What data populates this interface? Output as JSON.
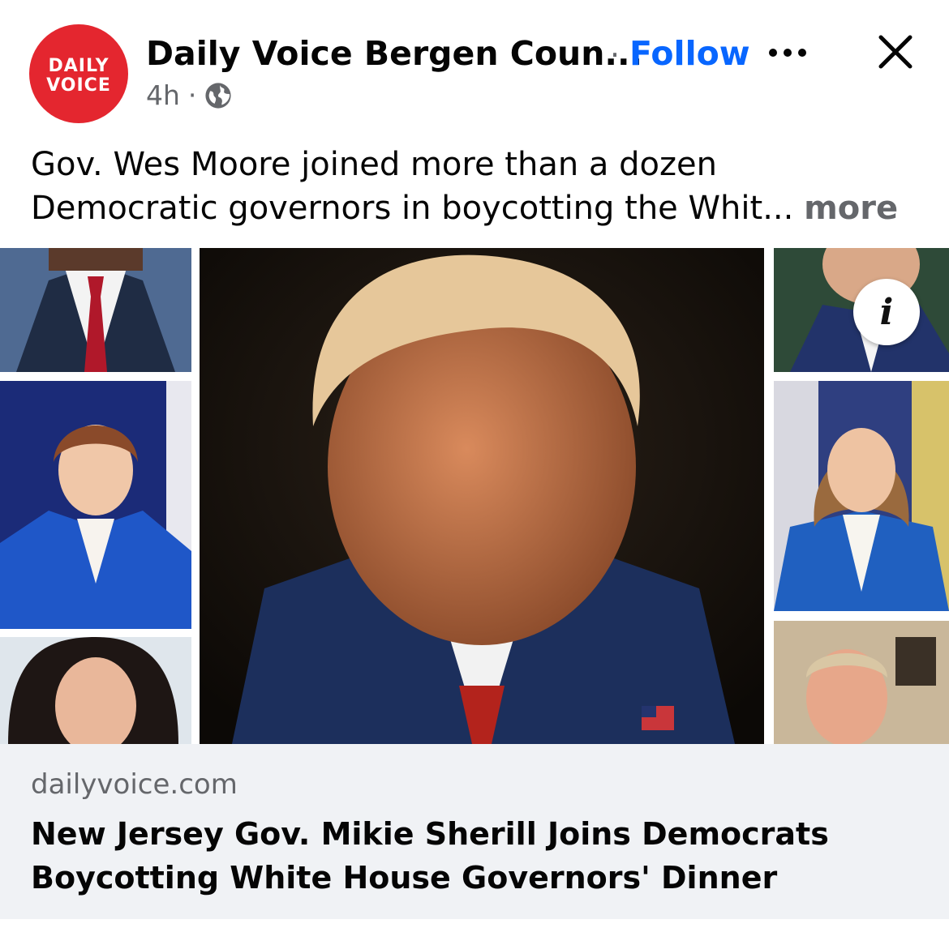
{
  "post": {
    "page_name": "Daily Voice Bergen Coun...",
    "separator": "·",
    "follow_label": "Follow",
    "timestamp": "4h",
    "meta_separator": "·",
    "audience_icon": "globe-icon",
    "more_options_icon": "ellipsis-icon",
    "close_icon": "close-icon",
    "avatar": {
      "line1": "DAILY",
      "line2": "VOICE"
    },
    "caption_line1": "Gov. Wes Moore joined more than a dozen",
    "caption_line2": "Democratic governors in boycotting the Whit...",
    "caption_more": "more"
  },
  "media": {
    "info_icon": "info-icon",
    "info_label": "i"
  },
  "link_preview": {
    "domain": "dailyvoice.com",
    "headline": "New Jersey Gov. Mikie Sherill Joins Democrats Boycotting White House Governors' Dinner"
  },
  "colors": {
    "brand_red": "#e4262f",
    "follow_blue": "#0866ff",
    "secondary_text": "#65676b",
    "card_bg": "#f0f2f5"
  }
}
